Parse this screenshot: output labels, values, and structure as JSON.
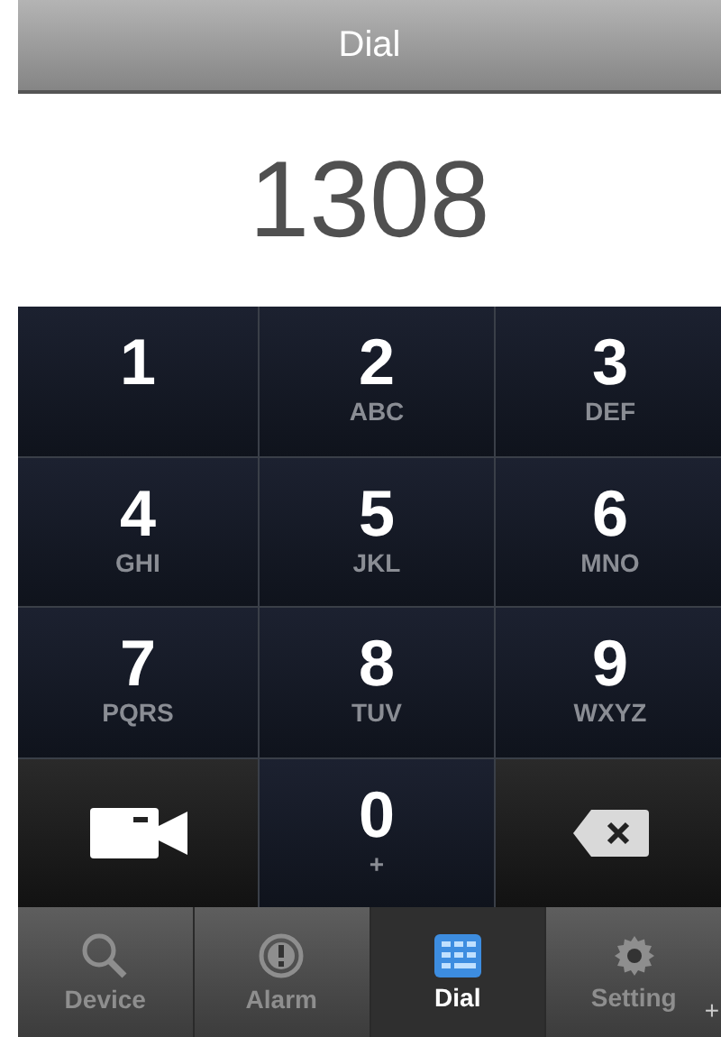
{
  "window": {
    "title": "Dial"
  },
  "display": {
    "value": "1308"
  },
  "keys": [
    {
      "kind": "digit",
      "digit": "1"
    },
    {
      "kind": "digit",
      "digit": "2",
      "letters": "ABC"
    },
    {
      "kind": "digit",
      "digit": "3",
      "letters": "DEF"
    },
    {
      "kind": "digit",
      "digit": "4",
      "letters": "GHI"
    },
    {
      "kind": "digit",
      "digit": "5",
      "letters": "JKL"
    },
    {
      "kind": "digit",
      "digit": "6",
      "letters": "MNO"
    },
    {
      "kind": "digit",
      "digit": "7",
      "letters": "PQRS"
    },
    {
      "kind": "digit",
      "digit": "8",
      "letters": "TUV"
    },
    {
      "kind": "digit",
      "digit": "9",
      "letters": "WXYZ"
    },
    {
      "kind": "video"
    },
    {
      "kind": "digit",
      "digit": "0",
      "letters": "+"
    },
    {
      "kind": "delete"
    }
  ],
  "tabs": [
    {
      "label": "Device",
      "kind": "search",
      "selected": false
    },
    {
      "label": "Alarm",
      "kind": "alert",
      "selected": false
    },
    {
      "label": "Dial",
      "kind": "keypad",
      "selected": true
    },
    {
      "label": "Setting",
      "kind": "gear",
      "selected": false,
      "badge": "+"
    }
  ]
}
